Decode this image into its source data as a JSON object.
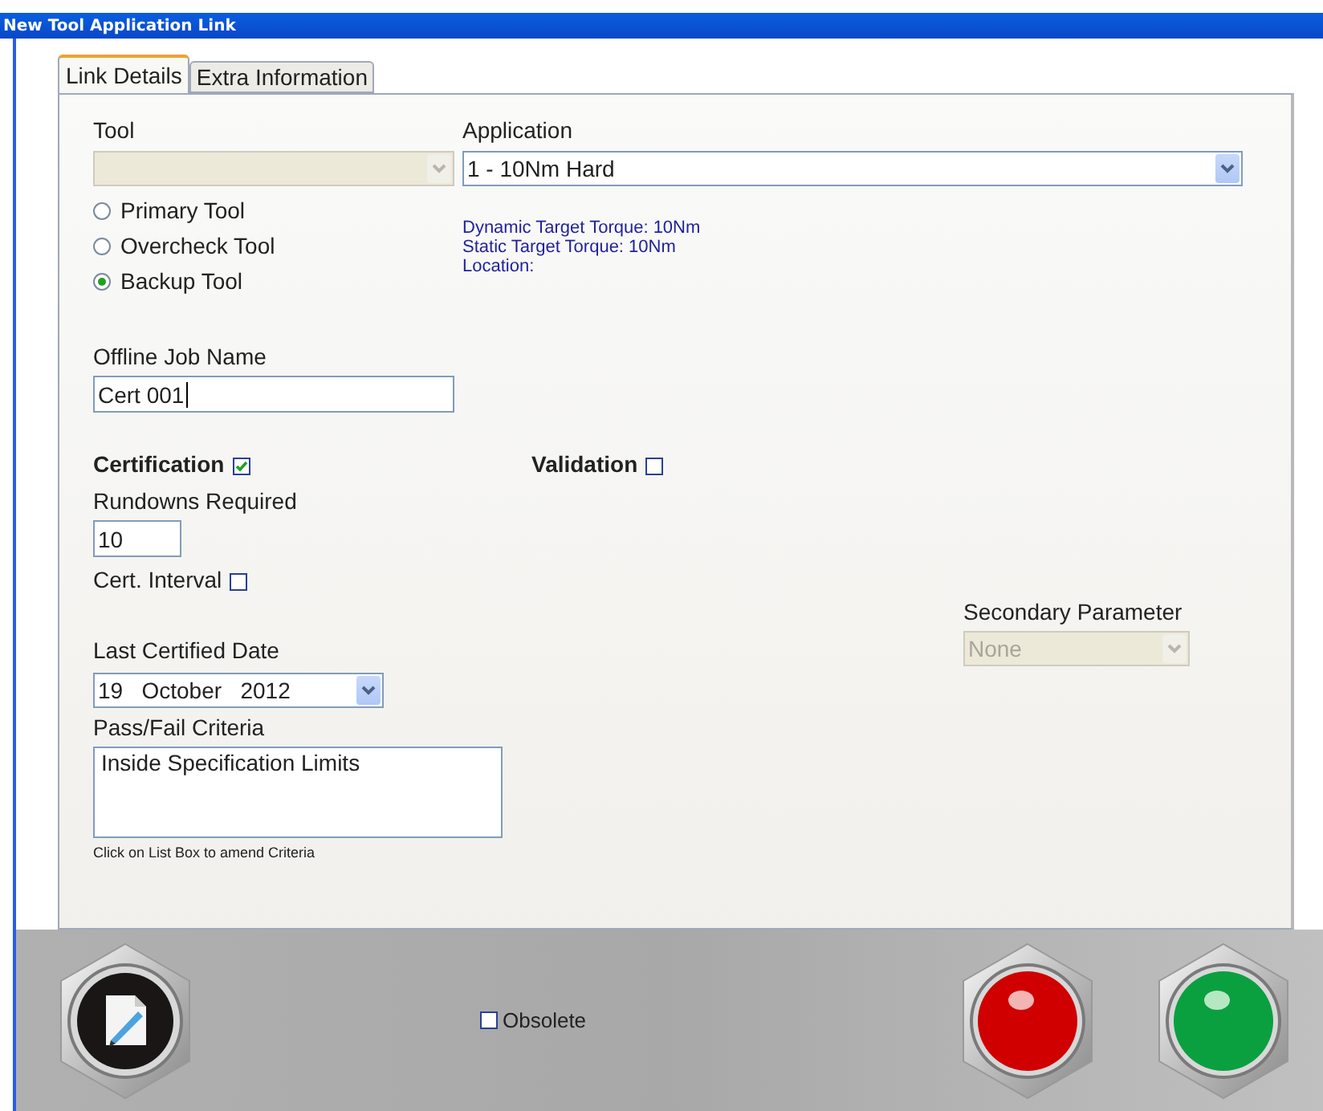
{
  "window": {
    "title": "New Tool Application Link"
  },
  "tabs": [
    {
      "label": "Link Details",
      "selected": true
    },
    {
      "label": "Extra Information",
      "selected": false
    }
  ],
  "tool": {
    "label": "Tool",
    "disabled": true
  },
  "tool_roles": [
    {
      "label": "Primary Tool",
      "selected": false
    },
    {
      "label": "Overcheck Tool",
      "selected": false
    },
    {
      "label": "Backup Tool",
      "selected": true
    }
  ],
  "application": {
    "label": "Application",
    "value": "1 - 10Nm Hard",
    "disabled": false
  },
  "application_info": [
    "Dynamic Target Torque: 10Nm",
    "Static Target Torque: 10Nm",
    "Location:"
  ],
  "offline_job_name": {
    "label": "Offline Job Name",
    "value": "Cert 001"
  },
  "certification": {
    "label": "Certification",
    "checked": true
  },
  "validation": {
    "label": "Validation",
    "checked": false
  },
  "rundowns_required": {
    "label": "Rundowns Required",
    "value": "10"
  },
  "cert_interval": {
    "label": "Cert. Interval",
    "checked": false
  },
  "last_certified_date": {
    "label": "Last Certified Date",
    "day": "19",
    "month": "October",
    "year": "2012"
  },
  "pass_fail_criteria": {
    "label": "Pass/Fail Criteria",
    "items": [
      "Inside Specification Limits"
    ],
    "hint": "Click on List Box to amend Criteria"
  },
  "secondary_parameter": {
    "label": "Secondary Parameter",
    "value": "None",
    "disabled": true
  },
  "obsolete": {
    "label": "Obsolete",
    "checked": false
  },
  "footer_buttons": [
    {
      "kind": "edit"
    },
    {
      "kind": "red"
    },
    {
      "kind": "green"
    }
  ]
}
